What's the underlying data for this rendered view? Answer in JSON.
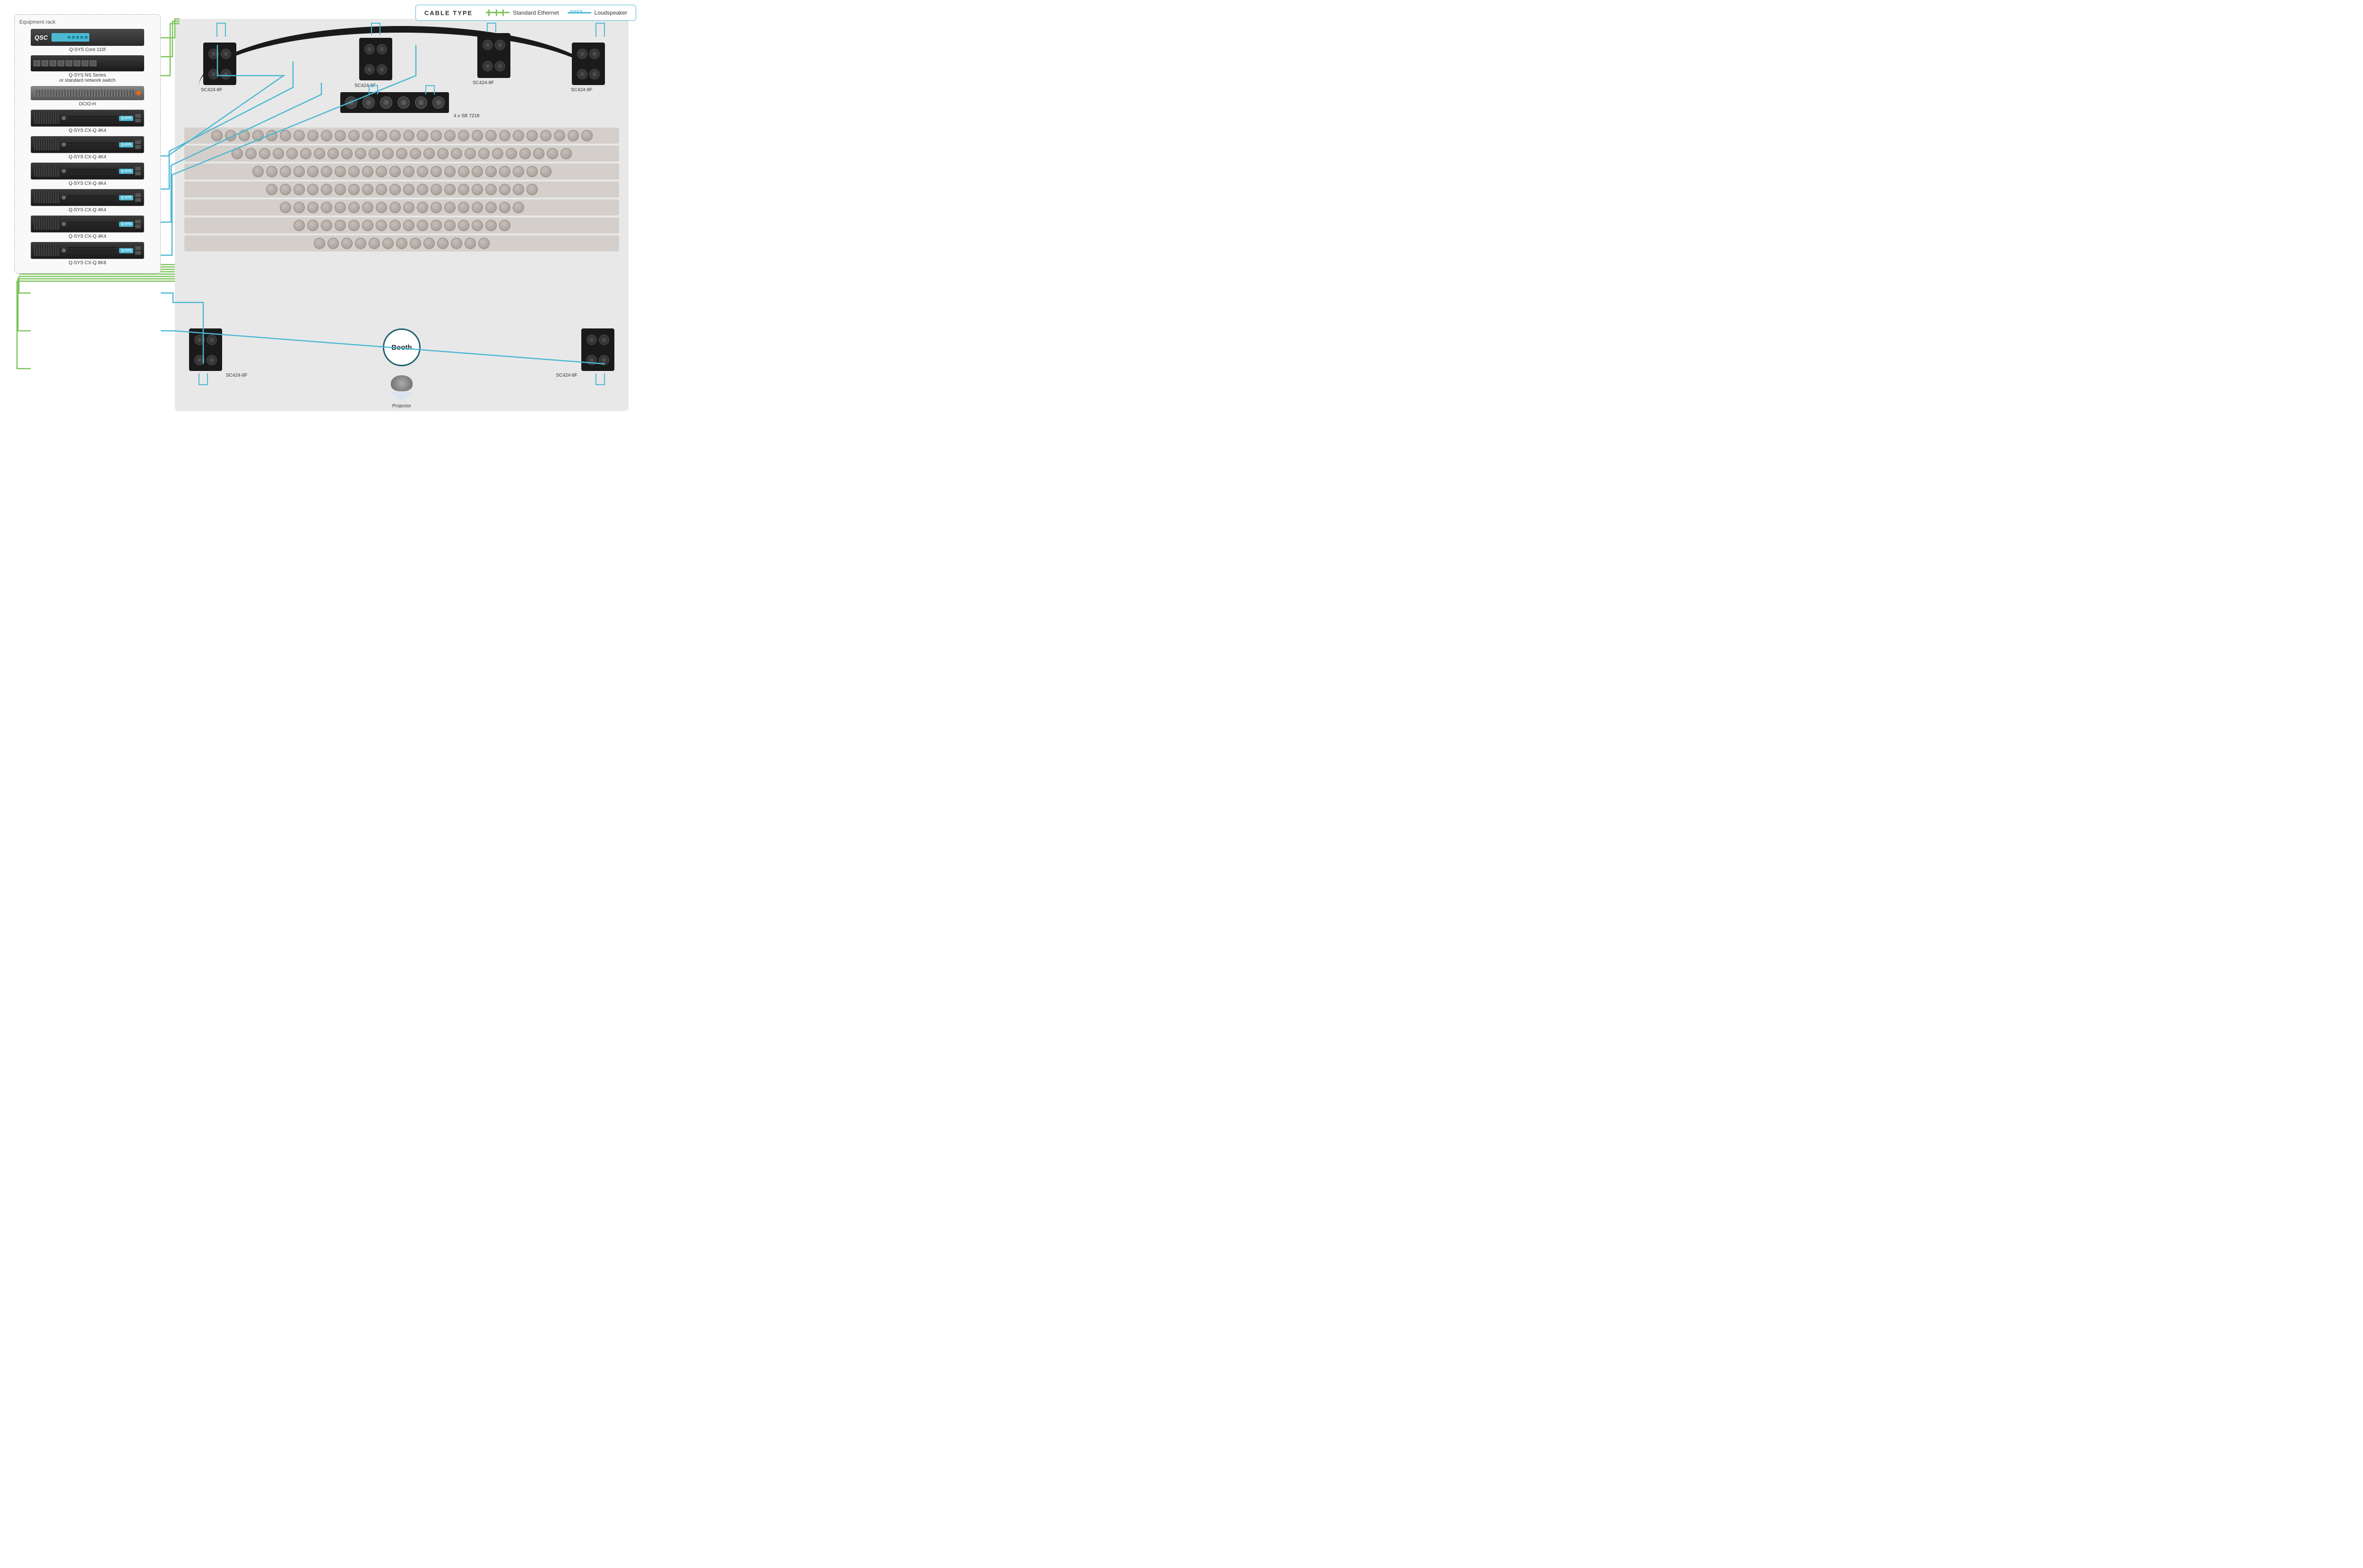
{
  "legend": {
    "title": "CABLE TYPE",
    "ethernet_label": "Standard Ethernet",
    "loudspeaker_label": "Loudspeaker"
  },
  "rack": {
    "title": "Equipment rack",
    "devices": [
      {
        "id": "qsc-core",
        "label": "Q-SYS Core 110f",
        "type": "core"
      },
      {
        "id": "ns-series",
        "label": "Q-SYS NS Series\nor standard network switch",
        "type": "switch"
      },
      {
        "id": "dcio-h",
        "label": "DCIO-H",
        "type": "dcio"
      },
      {
        "id": "cxq-1",
        "label": "Q-SYS CX-Q 4K4",
        "type": "cxq4"
      },
      {
        "id": "cxq-2",
        "label": "Q-SYS CX-Q 4K4",
        "type": "cxq4"
      },
      {
        "id": "cxq-3",
        "label": "Q-SYS CX-Q 4K4",
        "type": "cxq4"
      },
      {
        "id": "cxq-4",
        "label": "Q-SYS CX-Q 4K4",
        "type": "cxq4"
      },
      {
        "id": "cxq-5",
        "label": "Q-SYS CX-Q 4K4",
        "type": "cxq4"
      },
      {
        "id": "cxq-6",
        "label": "Q-SYS CX-Q 8K8",
        "type": "cxq8"
      }
    ]
  },
  "venue": {
    "speakers": [
      {
        "id": "spk-fl",
        "label": "SC424-8F",
        "position": "front-left"
      },
      {
        "id": "spk-fc",
        "label": "SC424-8F",
        "position": "front-center"
      },
      {
        "id": "spk-fr",
        "label": "SC424-8F",
        "position": "front-right"
      },
      {
        "id": "spk-frl",
        "label": "SC424-8F",
        "position": "front-right-large"
      },
      {
        "id": "spk-bl",
        "label": "SC424-8F",
        "position": "back-left"
      },
      {
        "id": "spk-br",
        "label": "SC424-8F",
        "position": "back-right"
      }
    ],
    "subwoofers": {
      "label": "4 x SB 7218",
      "count": 4
    },
    "booth": {
      "label": "Booth"
    },
    "projector": {
      "label": "Projector"
    }
  }
}
